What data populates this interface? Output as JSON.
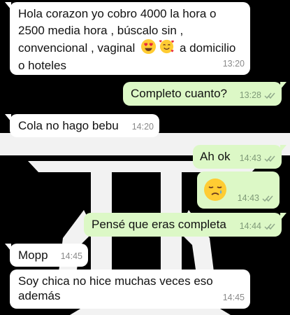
{
  "conversation": {
    "messages": [
      {
        "direction": "incoming",
        "lines": [
          "Hola corazon yo cobro 4000 la hora o",
          "2500 media hora , búscalo sin ,",
          "convencional , vaginal",
          "o hoteles"
        ],
        "inline_after_emojis": "a domicilio",
        "emojis": [
          "heart-eyes-face",
          "smiling-face-with-hearts"
        ],
        "time": "13:20"
      },
      {
        "direction": "outgoing",
        "text": "Completo cuanto?",
        "time": "13:28",
        "status": "read"
      },
      {
        "direction": "incoming",
        "text": "Cola no hago bebu",
        "time": "14:20"
      },
      {
        "direction": "outgoing",
        "text": "Ah ok",
        "time": "14:43",
        "status": "read"
      },
      {
        "direction": "outgoing",
        "emoji": "sad-relieved-face",
        "time": "14:43",
        "status": "read"
      },
      {
        "direction": "outgoing",
        "text": "Pensé que eras completa",
        "time": "14:44",
        "status": "read"
      },
      {
        "direction": "incoming",
        "text": "Mopp",
        "time": "14:45"
      },
      {
        "direction": "incoming",
        "lines": [
          "Soy chica no hice muchas veces eso",
          "además"
        ],
        "time": "14:45"
      }
    ]
  },
  "colors": {
    "incoming_bubble": "#ffffff",
    "outgoing_bubble": "#dcf8c6",
    "wallpaper": "#000000",
    "tick_read": "#8fa88a"
  }
}
